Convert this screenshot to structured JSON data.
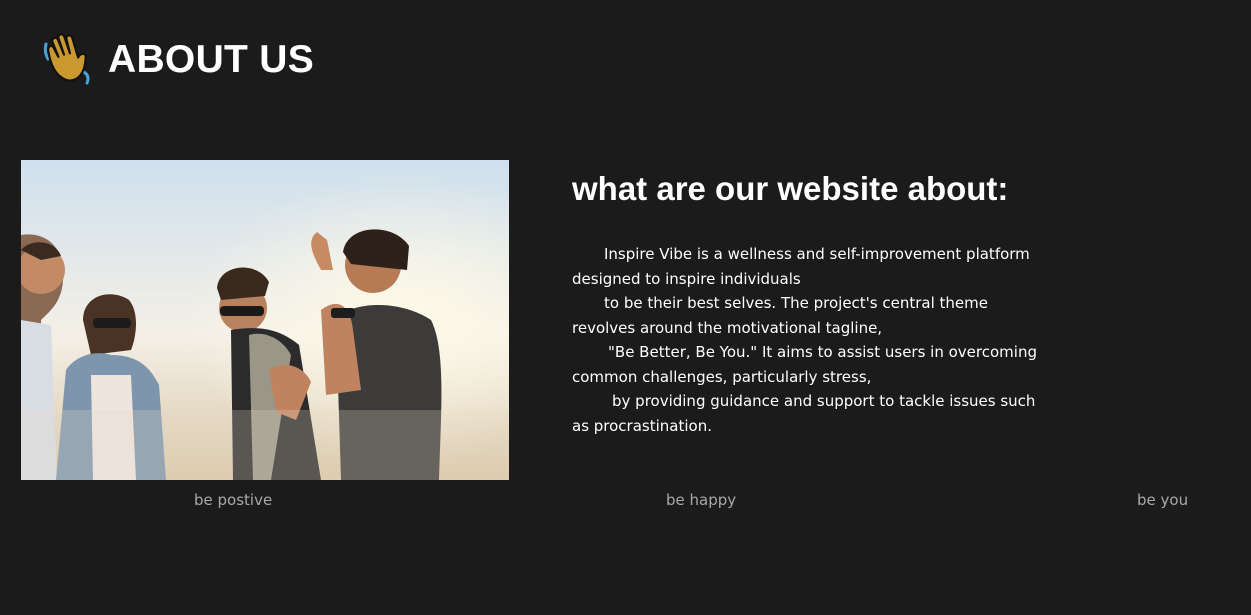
{
  "header": {
    "title": "ABOUT US",
    "icon": "waving-hand-icon"
  },
  "hero_image": {
    "icon": "group-of-friends-photo"
  },
  "about": {
    "heading": "what are our website about:",
    "lines": [
      "Inspire Vibe is a wellness and self-improvement platform",
      "designed to inspire individuals",
      "to be their best selves. The project's central theme",
      "revolves around the motivational tagline,",
      "\"Be Better, Be You.\" It aims to assist users in overcoming",
      "common challenges, particularly stress,",
      "by providing guidance and support to tackle issues such",
      "as procrastination."
    ]
  },
  "taglines": [
    "be postive",
    "be happy",
    "be you"
  ],
  "colors": {
    "background": "#1b1b1b",
    "text": "#ffffff",
    "muted": "#a8a8a8",
    "icon_skin": "#c9982e"
  }
}
